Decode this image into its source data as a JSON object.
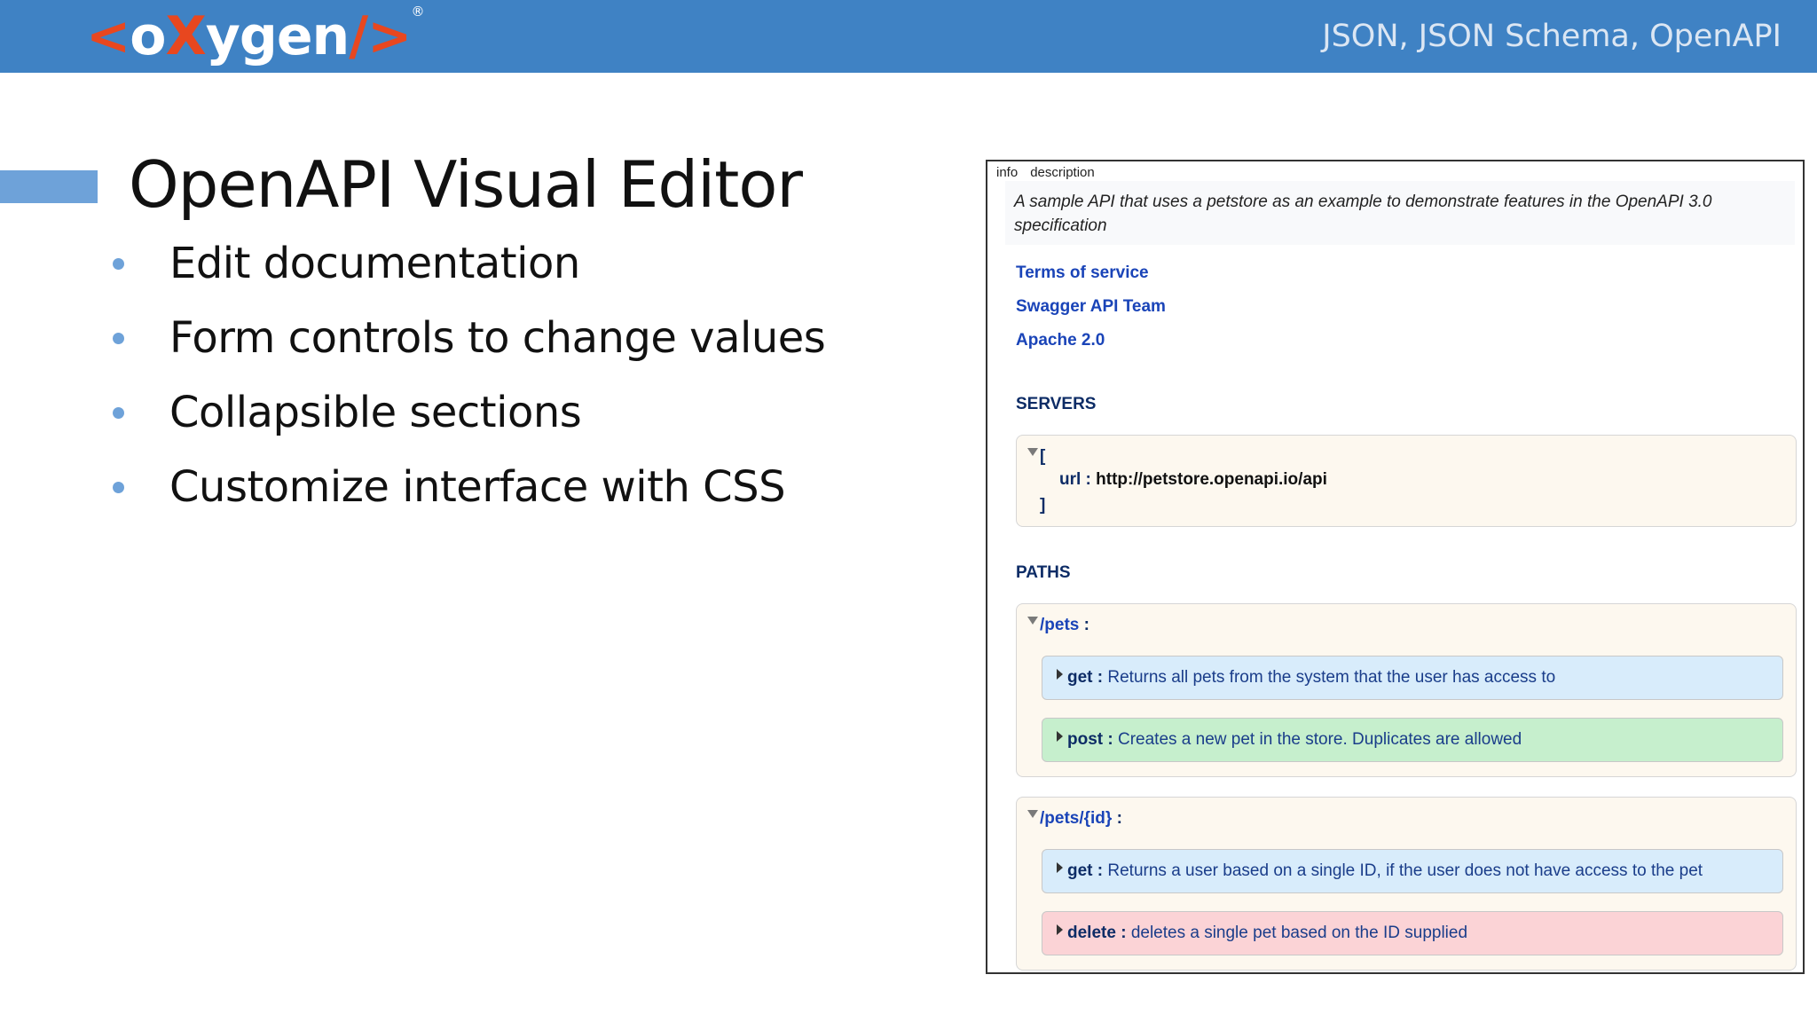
{
  "header": {
    "logo": {
      "open": "<",
      "o": "o",
      "x": "X",
      "rest": "ygen",
      "close": "/>",
      "registered": "®"
    },
    "subtitle": "JSON, JSON Schema, OpenAPI"
  },
  "slide": {
    "title": "OpenAPI Visual Editor",
    "bullets": [
      "Edit documentation",
      "Form controls to change values",
      "Collapsible sections",
      "Customize interface with CSS"
    ]
  },
  "editor": {
    "breadcrumb": [
      "info",
      "description"
    ],
    "description": "A sample API that uses a petstore as an example to demonstrate features in the OpenAPI 3.0 specification",
    "links": [
      "Terms of service",
      "Swagger API Team",
      "Apache 2.0"
    ],
    "servers": {
      "title": "SERVERS",
      "open_bracket": "[",
      "close_bracket": "]",
      "key": "url :",
      "value": "http://petstore.openapi.io/api"
    },
    "paths": {
      "title": "PATHS",
      "items": [
        {
          "name": "/pets",
          "colon": " :",
          "operations": [
            {
              "method": "get",
              "sep": " : ",
              "summary": "Returns all pets from the system that the user has access to"
            },
            {
              "method": "post",
              "sep": " : ",
              "summary": "Creates a new pet in the store. Duplicates are allowed"
            }
          ]
        },
        {
          "name": "/pets/{id}",
          "colon": " :",
          "operations": [
            {
              "method": "get",
              "sep": " : ",
              "summary": "Returns a user based on a single ID, if the user does not have access to the pet"
            },
            {
              "method": "delete",
              "sep": " : ",
              "summary": "deletes a single pet based on the ID supplied"
            }
          ]
        }
      ]
    }
  },
  "colors": {
    "header_bg": "#3f82c4",
    "logo_accent": "#e8471f",
    "bullet": "#6ea2d9",
    "get_bg": "#d8ecfb",
    "post_bg": "#c6efcd",
    "delete_bg": "#fbd3d6",
    "path_bg": "#fdf8ef"
  }
}
